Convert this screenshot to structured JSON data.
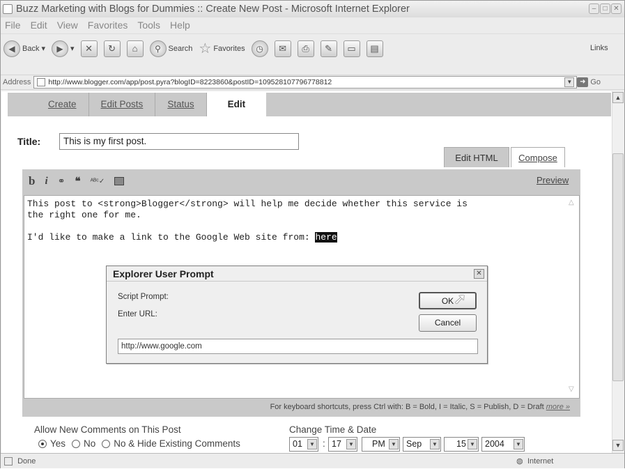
{
  "window": {
    "title": "Buzz Marketing with Blogs for Dummies :: Create New Post - Microsoft Internet Explorer"
  },
  "menu": [
    "File",
    "Edit",
    "View",
    "Favorites",
    "Tools",
    "Help"
  ],
  "toolbar": {
    "back": "Back",
    "search": "Search",
    "favorites": "Favorites",
    "links": "Links"
  },
  "address": {
    "label": "Address",
    "url": "http://www.blogger.com/app/post.pyra?blogID=8223860&postID=109528107796778812",
    "go": "Go"
  },
  "tabs": [
    "Create",
    "Edit Posts",
    "Status",
    "Edit"
  ],
  "post": {
    "title_label": "Title:",
    "title_value": "This is my first post.",
    "edit_html_tab": "Edit HTML",
    "compose_tab": "Compose",
    "format_buttons": [
      "b",
      "i",
      "link",
      "quote",
      "spell",
      "image"
    ],
    "preview": "Preview",
    "body_line1": "This post to <strong>Blogger</strong> will help me decide whether this service is",
    "body_line2": "the right one for me.",
    "body_line3": "I'd like to make a link to the Google Web site from: ",
    "body_selected": "here",
    "shortcuts": "For keyboard shortcuts, press Ctrl with: B = Bold, I = Italic, S = Publish, D = Draft",
    "more": "more »"
  },
  "dialog": {
    "title": "Explorer User Prompt",
    "script_prompt": "Script Prompt:",
    "enter_url": "Enter URL:",
    "ok": "OK",
    "cancel": "Cancel",
    "url_value": "http://www.google.com"
  },
  "comments": {
    "label": "Allow New Comments on This Post",
    "yes": "Yes",
    "no": "No",
    "hide": "No & Hide Existing Comments",
    "selected": "Yes"
  },
  "datetime": {
    "label": "Change Time & Date",
    "hour": "01",
    "minute": "17",
    "ampm": "PM",
    "month": "Sep",
    "day": "15",
    "year": "2004"
  },
  "status": {
    "left": "Done",
    "zone": "Internet"
  }
}
